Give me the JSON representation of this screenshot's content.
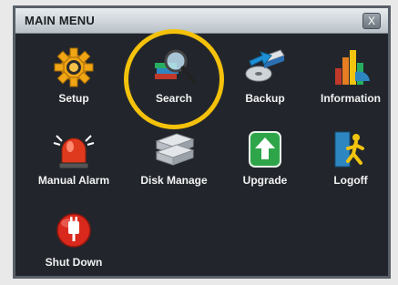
{
  "window": {
    "title": "MAIN MENU",
    "close_symbol": "X"
  },
  "items": [
    {
      "label": "Setup",
      "icon": "gear-icon"
    },
    {
      "label": "Search",
      "icon": "search-icon"
    },
    {
      "label": "Backup",
      "icon": "backup-icon"
    },
    {
      "label": "Information",
      "icon": "information-icon"
    },
    {
      "label": "Manual Alarm",
      "icon": "alarm-icon"
    },
    {
      "label": "Disk Manage",
      "icon": "disk-icon"
    },
    {
      "label": "Upgrade",
      "icon": "upgrade-icon"
    },
    {
      "label": "Logoff",
      "icon": "logoff-icon"
    },
    {
      "label": "Shut Down",
      "icon": "power-icon"
    }
  ],
  "colors": {
    "highlight": "#f5c20b",
    "panel": "#22262c",
    "text": "#f2f2f2"
  }
}
